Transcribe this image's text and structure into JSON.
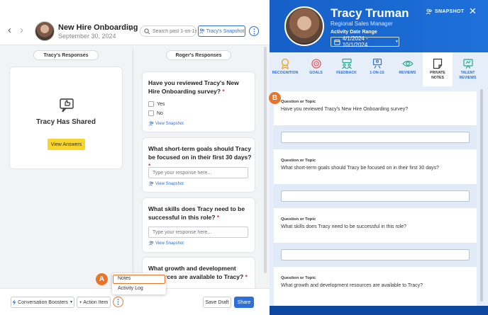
{
  "header": {
    "title": "New Hire Onboarding",
    "date": "September 30, 2024",
    "search_placeholder": "Search past 1-on-1s",
    "snapshot_button": "Tracy's Snapshot"
  },
  "columns": {
    "left": "Tracy's Responses",
    "right": "Roger's Responses"
  },
  "shared_card": {
    "title": "Tracy Has Shared",
    "button": "View Answers"
  },
  "questions": [
    {
      "text": "Have you reviewed Tracy's New Hire Onboarding survey?",
      "options": [
        "Yes",
        "No"
      ],
      "link": "View Snapshot"
    },
    {
      "text": "What short-term goals should Tracy be focused on in their first 30 days?",
      "placeholder": "Type your response here...",
      "link": "View Snapshot"
    },
    {
      "text": "What skills does Tracy need to be successful in this role?",
      "placeholder": "Type your response here...",
      "link": "View Snapshot"
    },
    {
      "text": "What growth and development resources are available to Tracy?"
    }
  ],
  "required_mark": "*",
  "footer": {
    "boosters": "Conversation Boosters",
    "action": "+ Action Item",
    "save": "Save Draft",
    "share": "Share"
  },
  "menu": {
    "notes": "Notes",
    "activity": "Activity Log"
  },
  "callouts": {
    "a": "A",
    "b": "B"
  },
  "profile": {
    "name": "Tracy Truman",
    "role": "Regional Sales Manager",
    "range_label": "Activity Date Range",
    "range_value": "4/1/2024 - 10/1/2024",
    "snapshot": "SNAPSHOT"
  },
  "tabs": [
    {
      "label": "RECOGNITION",
      "icon": "ribbon-icon"
    },
    {
      "label": "GOALS",
      "icon": "target-icon"
    },
    {
      "label": "FEEDBACK",
      "icon": "people-chat-icon"
    },
    {
      "label": "1-ON-1S",
      "icon": "one-on-one-icon"
    },
    {
      "label": "REVIEWS",
      "icon": "eye-review-icon"
    },
    {
      "label": "PRIVATE NOTES",
      "icon": "note-icon",
      "active": true
    },
    {
      "label": "TALENT REVIEWS",
      "icon": "talent-icon"
    }
  ],
  "notes": {
    "label": "Question or Topic",
    "items": [
      "Have you reviewed Tracy's New Hire Onboarding survey?",
      "What short-term goals should Tracy be focused on in their first 30 days?",
      "What skills does Tracy need to be successful in this role?",
      "What growth and development resources are available to Tracy?"
    ]
  },
  "colors": {
    "primary": "#2e6fd8",
    "header_blue": "#1660c8",
    "accent_orange": "#e8742a",
    "yellow_button": "#f9d42a",
    "required_red": "#d63b3b"
  }
}
